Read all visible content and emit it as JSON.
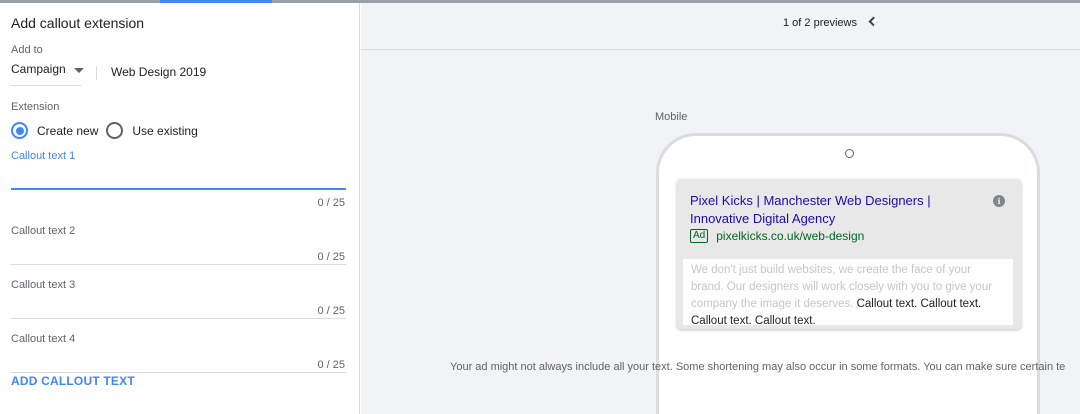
{
  "panel": {
    "title": "Add callout extension",
    "add_to_label": "Add to",
    "level_value": "Campaign",
    "campaign_name": "Web Design 2019",
    "extension_label": "Extension",
    "radio_create": "Create new",
    "radio_existing": "Use existing",
    "fields": [
      {
        "label": "Callout text 1",
        "value": "",
        "counter": "0 / 25"
      },
      {
        "label": "Callout text 2",
        "value": "",
        "counter": "0 / 25"
      },
      {
        "label": "Callout text 3",
        "value": "",
        "counter": "0 / 25"
      },
      {
        "label": "Callout text 4",
        "value": "",
        "counter": "0 / 25"
      }
    ],
    "add_link": "ADD CALLOUT TEXT"
  },
  "preview": {
    "count": "1 of 2 previews",
    "device_label": "Mobile",
    "headline": "Pixel Kicks | Manchester Web Designers | Innovative Digital Agency",
    "ad_badge": "Ad",
    "display_url": "pixelkicks.co.uk/web-design",
    "info_icon": "i",
    "description": "We don't just build websites, we create the face of your brand. Our designers will work closely with you to give your company the image it deserves.",
    "callouts": "Callout text. Callout text. Callout text. Callout text.",
    "footer_note": "Your ad might not always include all your text. Some shortening may also occur in some formats. You can make sure certain te"
  },
  "colors": {
    "accent": "#4285f4",
    "headline_link": "#1a0dab",
    "url_green": "#006621"
  },
  "icons": [
    "caret-down-icon",
    "chevron-left-icon",
    "chevron-right-icon",
    "info-icon",
    "camera-icon"
  ]
}
